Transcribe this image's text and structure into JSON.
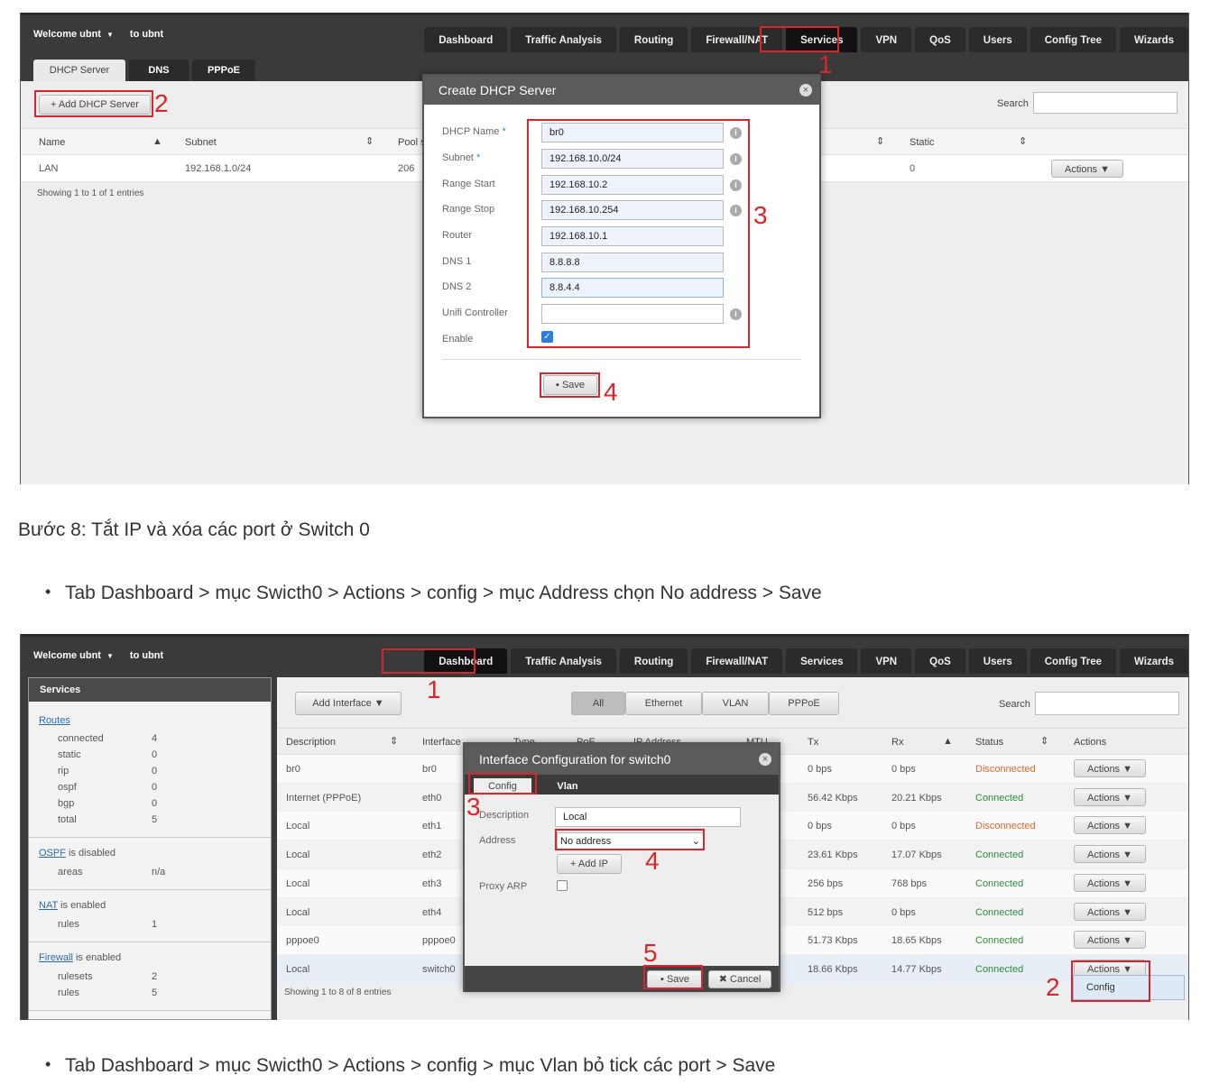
{
  "shot1": {
    "welcome": "Welcome ubnt",
    "to": "to ubnt",
    "nav": [
      "Dashboard",
      "Traffic Analysis",
      "Routing",
      "Firewall/NAT",
      "Services",
      "VPN",
      "QoS",
      "Users",
      "Config Tree",
      "Wizards"
    ],
    "subtabs": [
      "DHCP Server",
      "DNS",
      "PPPoE"
    ],
    "add_button": "Add DHCP Server",
    "search_label": "Search",
    "columns": {
      "name": "Name",
      "subnet": "Subnet",
      "pool": "Pool s",
      "static": "Static"
    },
    "row": {
      "name": "LAN",
      "subnet": "192.168.1.0/24",
      "pool": "206",
      "static": "0",
      "actions": "Actions"
    },
    "showing": "Showing 1 to 1 of 1 entries",
    "modal": {
      "title": "Create DHCP Server",
      "labels": [
        "DHCP Name",
        "Subnet",
        "Range Start",
        "Range Stop",
        "Router",
        "DNS 1",
        "DNS 2",
        "Unifi Controller",
        "Enable"
      ],
      "values": [
        "br0",
        "192.168.10.0/24",
        "192.168.10.2",
        "192.168.10.254",
        "192.168.10.1",
        "8.8.8.8",
        "8.8.4.4",
        ""
      ],
      "save": "Save"
    },
    "markers": [
      "1",
      "2",
      "3",
      "4"
    ]
  },
  "step_text": "Bước 8: Tắt IP và xóa các port ở Switch 0",
  "bullet1": "Tab Dashboard > mục Swicth0 > Actions > config > mục Address chọn No address > Save",
  "bullet2": "Tab Dashboard > mục Swicth0 > Actions > config > mục Vlan bỏ tick các port > Save",
  "shot2": {
    "welcome": "Welcome ubnt",
    "to": "to ubnt",
    "nav": [
      "Dashboard",
      "Traffic Analysis",
      "Routing",
      "Firewall/NAT",
      "Services",
      "VPN",
      "QoS",
      "Users",
      "Config Tree",
      "Wizards"
    ],
    "sidebar": {
      "title": "Services",
      "routes_link": "Routes",
      "routes": [
        [
          "connected",
          "4"
        ],
        [
          "static",
          "0"
        ],
        [
          "rip",
          "0"
        ],
        [
          "ospf",
          "0"
        ],
        [
          "bgp",
          "0"
        ],
        [
          "total",
          "5"
        ]
      ],
      "ospf_link": "OSPF",
      "ospf_text": "is disabled",
      "areas": [
        "areas",
        "n/a"
      ],
      "nat_link": "NAT",
      "nat_text": "is enabled",
      "nat_rules": [
        "rules",
        "1"
      ],
      "fw_link": "Firewall",
      "fw_text": "is enabled",
      "fw_rows": [
        [
          "rulesets",
          "2"
        ],
        [
          "rules",
          "5"
        ]
      ]
    },
    "add_interface": "Add Interface",
    "filters": [
      "All",
      "Ethernet",
      "VLAN",
      "PPPoE"
    ],
    "search_label": "Search",
    "columns": [
      "Description",
      "Interface",
      "Type",
      "PoE",
      "IP Address",
      "MTU",
      "Tx",
      "Rx",
      "Status",
      "Actions"
    ],
    "rows": [
      {
        "desc": "br0",
        "iface": "br0",
        "tx": "0 bps",
        "rx": "0 bps",
        "status": "Disconnected"
      },
      {
        "desc": "Internet (PPPoE)",
        "iface": "eth0",
        "tx": "56.42 Kbps",
        "rx": "20.21 Kbps",
        "status": "Connected"
      },
      {
        "desc": "Local",
        "iface": "eth1",
        "tx": "0 bps",
        "rx": "0 bps",
        "status": "Disconnected"
      },
      {
        "desc": "Local",
        "iface": "eth2",
        "tx": "23.61 Kbps",
        "rx": "17.07 Kbps",
        "status": "Connected"
      },
      {
        "desc": "Local",
        "iface": "eth3",
        "tx": "256 bps",
        "rx": "768 bps",
        "status": "Connected"
      },
      {
        "desc": "Local",
        "iface": "eth4",
        "tx": "512 bps",
        "rx": "0 bps",
        "status": "Connected"
      },
      {
        "desc": "pppoe0",
        "iface": "pppoe0",
        "tx": "51.73 Kbps",
        "rx": "18.65 Kbps",
        "status": "Connected"
      },
      {
        "desc": "Local",
        "iface": "switch0",
        "tx": "18.66 Kbps",
        "rx": "14.77 Kbps",
        "status": "Connected"
      }
    ],
    "actions_label": "Actions",
    "showing": "Showing 1 to 8 of 8 entries",
    "menu_item": "Config",
    "modal": {
      "title": "Interface Configuration for switch0",
      "tabs": [
        "Config",
        "Vlan"
      ],
      "desc_label": "Description",
      "desc_value": "Local",
      "address_label": "Address",
      "address_value": "No address",
      "add_ip": "Add IP",
      "proxy_arp": "Proxy ARP",
      "save": "Save",
      "cancel": "Cancel"
    },
    "markers": [
      "1",
      "2",
      "3",
      "4",
      "5"
    ]
  },
  "colors": {
    "red": "#d9262c",
    "connected": "#2e8b3a",
    "disconnected": "#e0662a",
    "link": "#2a6bb0"
  }
}
